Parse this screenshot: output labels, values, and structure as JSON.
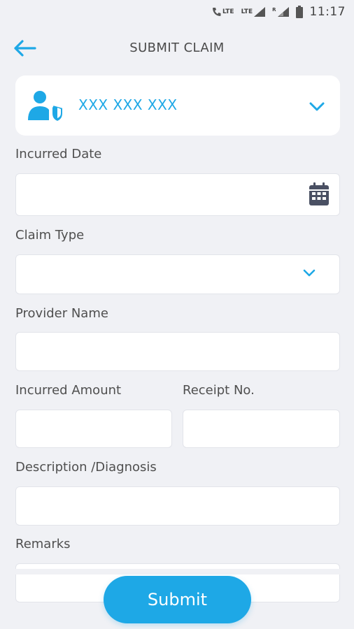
{
  "status_bar": {
    "call_lte": "LTE",
    "lte": "LTE",
    "roaming": "R",
    "time": "11:17"
  },
  "header": {
    "title": "SUBMIT CLAIM",
    "back_icon": "arrow-left-icon"
  },
  "member": {
    "name": "XXX XXX XXX",
    "icon": "user-shield-icon"
  },
  "form": {
    "incurred_date": {
      "label": "Incurred Date",
      "value": "",
      "icon": "calendar-icon"
    },
    "claim_type": {
      "label": "Claim Type",
      "value": ""
    },
    "provider_name": {
      "label": "Provider Name",
      "value": ""
    },
    "incurred_amount": {
      "label": "Incurred Amount",
      "value": ""
    },
    "receipt_no": {
      "label": "Receipt No.",
      "value": ""
    },
    "description": {
      "label": "Description /Diagnosis",
      "value": ""
    },
    "remarks": {
      "label": "Remarks",
      "value": ""
    }
  },
  "submit_label": "Submit",
  "colors": {
    "accent": "#1ea8e6",
    "background": "#f0f1f5",
    "card": "#ffffff",
    "label_text": "#4f4f4f"
  }
}
